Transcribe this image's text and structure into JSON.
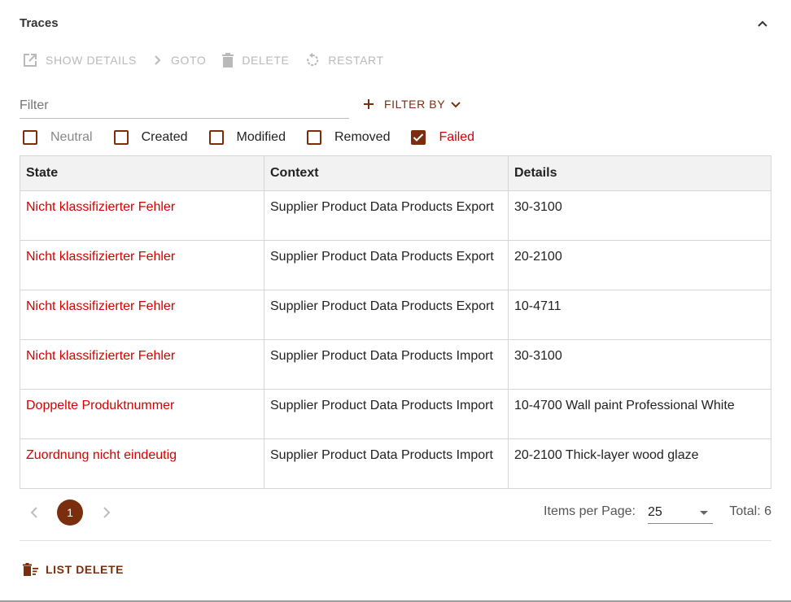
{
  "panel": {
    "title": "Traces"
  },
  "toolbar": {
    "show_details": "SHOW DETAILS",
    "goto": "GOTO",
    "delete": "DELETE",
    "restart": "RESTART"
  },
  "filter": {
    "placeholder": "Filter",
    "value": "",
    "filter_by_label": "FILTER BY"
  },
  "checkboxes": {
    "neutral": {
      "label": "Neutral",
      "checked": false
    },
    "created": {
      "label": "Created",
      "checked": false
    },
    "modified": {
      "label": "Modified",
      "checked": false
    },
    "removed": {
      "label": "Removed",
      "checked": false
    },
    "failed": {
      "label": "Failed",
      "checked": true
    }
  },
  "table": {
    "headers": [
      "State",
      "Context",
      "Details"
    ],
    "rows": [
      {
        "state": "Nicht klassifizierter Fehler",
        "context": "Supplier Product Data Products Export",
        "details": "30-3100"
      },
      {
        "state": "Nicht klassifizierter Fehler",
        "context": "Supplier Product Data Products Export",
        "details": "20-2100"
      },
      {
        "state": "Nicht klassifizierter Fehler",
        "context": "Supplier Product Data Products Export",
        "details": "10-4711"
      },
      {
        "state": "Nicht klassifizierter Fehler",
        "context": "Supplier Product Data Products Import",
        "details": "30-3100"
      },
      {
        "state": "Doppelte Produktnummer",
        "context": "Supplier Product Data Products Import",
        "details": "10-4700 Wall paint Professional White"
      },
      {
        "state": "Zuordnung nicht eindeutig",
        "context": "Supplier Product Data Products Import",
        "details": "20-2100 Thick-layer wood glaze"
      }
    ]
  },
  "pagination": {
    "current_page": "1",
    "items_per_page_label": "Items per Page:",
    "items_per_page_value": "25",
    "total_label": "Total: 6"
  },
  "footer": {
    "list_delete": "LIST DELETE"
  },
  "colors": {
    "accent": "#7a2e0e",
    "error": "#d50000",
    "disabled": "#b9b9b9"
  },
  "icons": [
    "chevron-up-icon",
    "open-external-icon",
    "chevron-right-icon",
    "trash-icon",
    "restart-icon",
    "plus-icon",
    "chevron-down-icon",
    "check-icon",
    "chevron-left-icon",
    "list-delete-icon"
  ]
}
